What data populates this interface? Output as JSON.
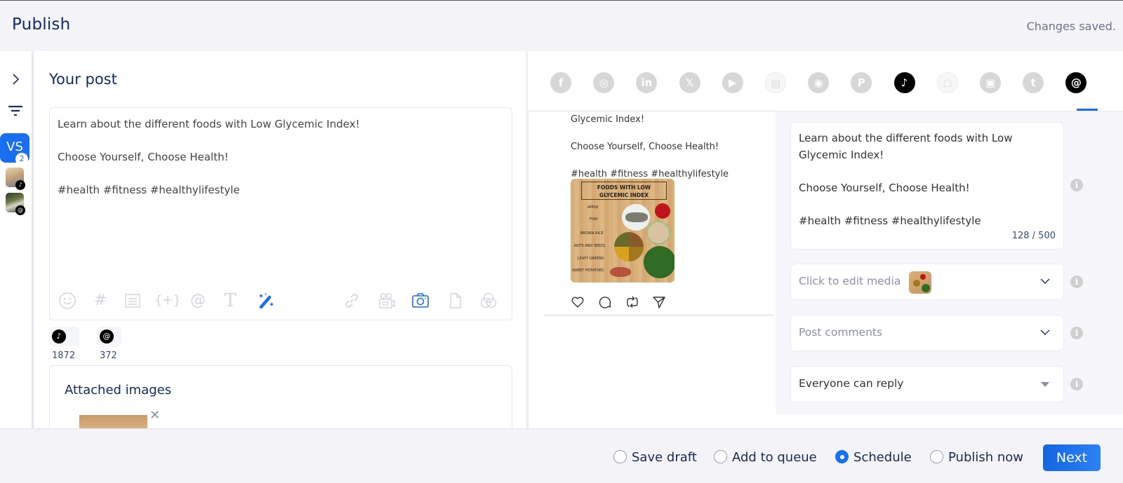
{
  "header": {
    "title": "Publish",
    "status": "Changes saved."
  },
  "sidebar": {
    "expand_icon": "chevron-right-icon",
    "filter_icon": "filter-icon",
    "group": {
      "initials": "VS",
      "count": "2",
      "color": "#1a6ef0"
    },
    "accounts": [
      {
        "network": "tiktok",
        "badge_glyph": "♪"
      },
      {
        "network": "threads",
        "badge_glyph": "@"
      }
    ]
  },
  "editor": {
    "heading": "Your post",
    "content": "Learn about the different foods with Low Glycemic Index!\n\nChoose Yourself, Choose Health!\n\n #health #fitness #healthylifestyle",
    "tools_left": [
      "emoji-icon",
      "hashtag-icon",
      "snippet-icon",
      "variable-icon",
      "mention-icon",
      "text-format-icon",
      "ai-magic-wand-icon"
    ],
    "tools_right": [
      "link-icon",
      "video-icon",
      "camera-icon",
      "document-icon",
      "canva-icon"
    ],
    "tool_glyphs": {
      "emoji": "☺",
      "hashtag": "#",
      "variable": "{+}",
      "mention": "@",
      "text": "T"
    },
    "char_counts": [
      {
        "network": "tiktok",
        "glyph": "♪",
        "count": "1872"
      },
      {
        "network": "threads",
        "glyph": "@",
        "count": "372"
      }
    ],
    "accent": "#1a6ef0"
  },
  "attachments": {
    "heading": "Attached images",
    "remove_glyph": "✕"
  },
  "networks": [
    {
      "name": "facebook",
      "glyph": "f",
      "state": "inactive"
    },
    {
      "name": "instagram",
      "glyph": "◎",
      "state": "inactive"
    },
    {
      "name": "linkedin",
      "glyph": "in",
      "state": "inactive"
    },
    {
      "name": "x",
      "glyph": "𝕏",
      "state": "inactive"
    },
    {
      "name": "youtube",
      "glyph": "▶",
      "state": "inactive"
    },
    {
      "name": "google-business",
      "glyph": "▤",
      "state": "faint"
    },
    {
      "name": "reddit",
      "glyph": "◉",
      "state": "inactive"
    },
    {
      "name": "pinterest",
      "glyph": "P",
      "state": "inactive"
    },
    {
      "name": "tiktok",
      "glyph": "♪",
      "state": "active"
    },
    {
      "name": "snapchat",
      "glyph": "☖",
      "state": "faint"
    },
    {
      "name": "contact-card",
      "glyph": "▣",
      "state": "inactive"
    },
    {
      "name": "tumblr",
      "glyph": "t",
      "state": "inactive"
    },
    {
      "name": "threads",
      "glyph": "@",
      "state": "active-selected"
    }
  ],
  "preview": {
    "text": "Glycemic Index!\nChoose Yourself, Choose Health!\n#health #fitness #healthylifestyle",
    "image": {
      "title": "FOODS WITH LOW\nGLYCEMIC INDEX",
      "labels": [
        "APPLE",
        "FISH",
        "BROWN RICE",
        "NUTS AND SEEDS",
        "LEAFY GREENS",
        "SWEET POTATOES"
      ]
    },
    "actions": [
      "like-icon",
      "comment-icon",
      "repost-icon",
      "share-icon"
    ]
  },
  "settings": {
    "text": "Learn about the different foods with Low\nGlycemic Index!\n\nChoose Yourself, Choose Health!\n\n#health #fitness #healthylifestyle",
    "char_meter": "128 / 500",
    "media_label": "Click to edit media",
    "comments_label": "Post comments",
    "reply_setting": "Everyone can reply",
    "info_glyph": "i"
  },
  "footer": {
    "options": [
      {
        "label": "Save draft",
        "selected": false
      },
      {
        "label": "Add to queue",
        "selected": false
      },
      {
        "label": "Schedule",
        "selected": true
      },
      {
        "label": "Publish now",
        "selected": false
      }
    ],
    "next_label": "Next"
  }
}
